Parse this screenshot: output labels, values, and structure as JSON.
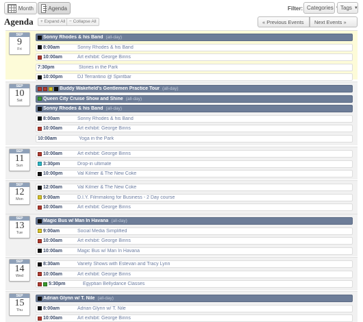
{
  "toolbar": {
    "month_label": "Month",
    "agenda_label": "Agenda",
    "filter_label": "Filter:",
    "categories_label": "Categories",
    "tags_label": "Tags"
  },
  "header": {
    "title": "Agenda",
    "expand_all": "+ Expand All",
    "collapse_all": "− Collapse All",
    "prev_label": "« Previous Events",
    "next_label": "Next Events »"
  },
  "colors": {
    "black": "#111111",
    "red": "#b03a2e",
    "yellow": "#d8c42a",
    "cyan": "#29b6c6",
    "green": "#3a9a2e"
  },
  "days": [
    {
      "month": "SEP",
      "num": "9",
      "weekday": "Fri",
      "today": true,
      "events": [
        {
          "allday": true,
          "colors": [
            "#111111"
          ],
          "title": "Sonny Rhodes & his Band",
          "tag": "(all-day)"
        },
        {
          "time": "8:00am",
          "colors": [
            "#111111"
          ],
          "title": "Sonny Rhodes & his Band"
        },
        {
          "time": "10:00am",
          "colors": [
            "#b03a2e"
          ],
          "title": "Art exhibit: George Binns"
        },
        {
          "time": "7:30pm",
          "colors": [],
          "title": "Stories in the Park"
        },
        {
          "time": "10:00pm",
          "colors": [
            "#111111"
          ],
          "title": "DJ Terrantino @ Spiritbar"
        }
      ]
    },
    {
      "month": "SEP",
      "num": "10",
      "weekday": "Sat",
      "today": false,
      "events": [
        {
          "allday": true,
          "colors": [
            "#b03a2e",
            "#b03a2e",
            "#d8c42a",
            "#111111"
          ],
          "title": "Buddy Wakefield's Gentlemen Practice Tour",
          "tag": "(all-day)"
        },
        {
          "allday": true,
          "colors": [
            "#3a9a2e"
          ],
          "title": "Queen City Cruise Show and Shine",
          "tag": "(all-day)"
        },
        {
          "allday": true,
          "colors": [
            "#111111"
          ],
          "title": "Sonny Rhodes & his Band",
          "tag": "(all-day)"
        },
        {
          "time": "8:00am",
          "colors": [
            "#111111"
          ],
          "title": "Sonny Rhodes & his Band"
        },
        {
          "time": "10:00am",
          "colors": [
            "#b03a2e"
          ],
          "title": "Art exhibit: George Binns"
        },
        {
          "time": "10:00am",
          "colors": [],
          "title": "Yoga in the Park"
        }
      ]
    },
    {
      "month": "SEP",
      "num": "11",
      "weekday": "Sun",
      "today": false,
      "events": [
        {
          "time": "10:00am",
          "colors": [
            "#b03a2e"
          ],
          "title": "Art exhibit: George Binns"
        },
        {
          "time": "3:30pm",
          "colors": [
            "#29b6c6"
          ],
          "title": "Drop-in ultimate"
        },
        {
          "time": "10:00pm",
          "colors": [
            "#111111"
          ],
          "title": "Val Kilmer & The New Coke"
        }
      ]
    },
    {
      "month": "SEP",
      "num": "12",
      "weekday": "Mon",
      "today": false,
      "events": [
        {
          "time": "12:00am",
          "colors": [
            "#111111"
          ],
          "title": "Val Kilmer & The New Coke"
        },
        {
          "time": "9:00am",
          "colors": [
            "#d8c42a"
          ],
          "title": "D.I.Y. Filmmaking for Business - 2 Day course"
        },
        {
          "time": "10:00am",
          "colors": [
            "#b03a2e"
          ],
          "title": "Art exhibit: George Binns"
        }
      ]
    },
    {
      "month": "SEP",
      "num": "13",
      "weekday": "Tue",
      "today": false,
      "events": [
        {
          "allday": true,
          "colors": [
            "#111111"
          ],
          "title": "Magic Bus w/ Man In Havana",
          "tag": "(all-day)"
        },
        {
          "time": "9:00am",
          "colors": [
            "#d8c42a"
          ],
          "title": "Social Media Simplified"
        },
        {
          "time": "10:00am",
          "colors": [
            "#b03a2e"
          ],
          "title": "Art exhibit: George Binns"
        },
        {
          "time": "10:00am",
          "colors": [
            "#111111"
          ],
          "title": "Magic Bus w/ Man In Havana"
        }
      ]
    },
    {
      "month": "SEP",
      "num": "14",
      "weekday": "Wed",
      "today": false,
      "events": [
        {
          "time": "8:30am",
          "colors": [
            "#111111"
          ],
          "title": "Variety Shows with Estevan and Tracy Lynn"
        },
        {
          "time": "10:00am",
          "colors": [
            "#b03a2e"
          ],
          "title": "Art exhibit: George Binns"
        },
        {
          "time": "5:30pm",
          "colors": [
            "#b03a2e",
            "#3a9a2e"
          ],
          "title": "Egyptian Bellydance Classes"
        }
      ]
    },
    {
      "month": "SEP",
      "num": "15",
      "weekday": "Thu",
      "today": false,
      "events": [
        {
          "allday": true,
          "colors": [
            "#111111"
          ],
          "title": "Adrian Glynn w/ T. Nile",
          "tag": "(all-day)"
        },
        {
          "time": "8:00am",
          "colors": [
            "#111111"
          ],
          "title": "Adrian Glynn w/ T. Nile"
        },
        {
          "time": "10:00am",
          "colors": [
            "#b03a2e"
          ],
          "title": "Art exhibit: George Binns"
        }
      ]
    }
  ]
}
